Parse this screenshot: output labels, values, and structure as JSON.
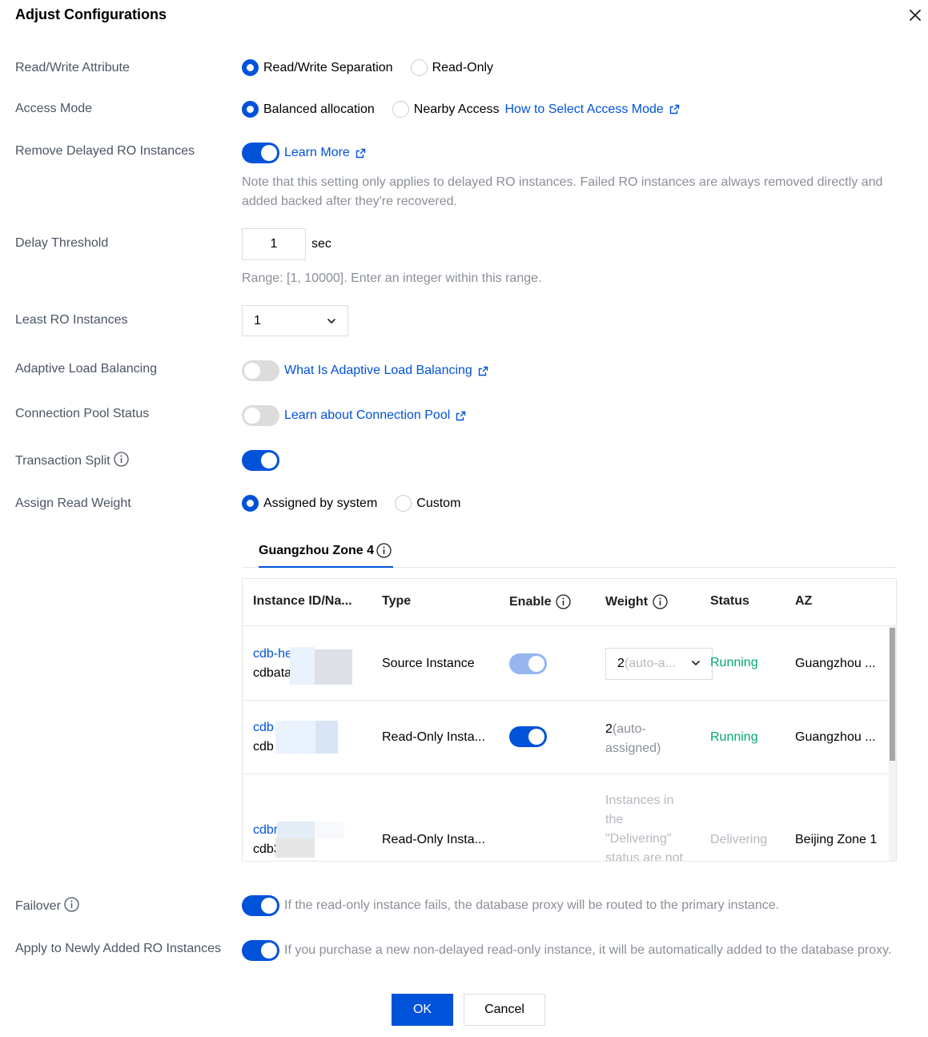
{
  "dialog": {
    "title": "Adjust Configurations",
    "ok_label": "OK",
    "cancel_label": "Cancel"
  },
  "rw_attribute": {
    "label": "Read/Write Attribute",
    "options": [
      "Read/Write Separation",
      "Read-Only"
    ],
    "selected": "Read/Write Separation"
  },
  "access_mode": {
    "label": "Access Mode",
    "options": [
      "Balanced allocation",
      "Nearby Access"
    ],
    "selected": "Balanced allocation",
    "help_link": "How to Select Access Mode"
  },
  "remove_delayed": {
    "label": "Remove Delayed RO Instances",
    "enabled": true,
    "link": "Learn More",
    "note_line1": "Note that this setting only applies to delayed RO instances. Failed RO instances are always removed directly and",
    "note_line2": "added backed after they're recovered."
  },
  "delay_threshold": {
    "label": "Delay Threshold",
    "value": "1",
    "unit": "sec",
    "hint": "Range: [1, 10000]. Enter an integer within this range."
  },
  "least_ro": {
    "label": "Least RO Instances",
    "value": "1"
  },
  "adaptive_lb": {
    "label": "Adaptive Load Balancing",
    "enabled": false,
    "link": "What Is Adaptive Load Balancing"
  },
  "conn_pool": {
    "label": "Connection Pool Status",
    "enabled": false,
    "link": "Learn about Connection Pool"
  },
  "txn_split": {
    "label": "Transaction Split",
    "enabled": true
  },
  "read_weight": {
    "label": "Assign Read Weight",
    "options": [
      "Assigned by system",
      "Custom"
    ],
    "selected": "Assigned by system"
  },
  "zone_tab": {
    "label": "Guangzhou Zone 4"
  },
  "table": {
    "columns": [
      "Instance ID/Na...",
      "Type",
      "Enable",
      "Weight",
      "Status",
      "AZ"
    ],
    "rows": [
      {
        "id": "cdb-he",
        "name": "cdbata",
        "type": "Source Instance",
        "enable": true,
        "weight_value": "2",
        "weight_placeholder": "(auto-a...",
        "status": "Running",
        "az": "Guangzhou ..."
      },
      {
        "id": "cdb",
        "name": "cdb",
        "type": "Read-Only Insta...",
        "enable": true,
        "weight_value": "2",
        "weight_note_1": "(auto-",
        "weight_note_2": "assigned)",
        "status": "Running",
        "az": "Guangzhou ..."
      },
      {
        "id": "cdbr",
        "name": "cdb3",
        "type": "Read-Only Insta...",
        "weight_lines": [
          "Instances in",
          "the",
          "\"Delivering\"",
          "status are not"
        ],
        "status": "Delivering",
        "az": "Beijing Zone 1"
      }
    ]
  },
  "failover": {
    "label": "Failover",
    "enabled": true,
    "text": "If the read-only instance fails, the database proxy will be routed to the primary instance."
  },
  "apply_new": {
    "label": "Apply to Newly Added RO Instances",
    "enabled": true,
    "text": "If you purchase a new non-delayed read-only instance, it will be automatically added to the database proxy."
  },
  "colors": {
    "primary": "#0052d9",
    "running": "#00a870",
    "muted": "#8a8f99"
  }
}
